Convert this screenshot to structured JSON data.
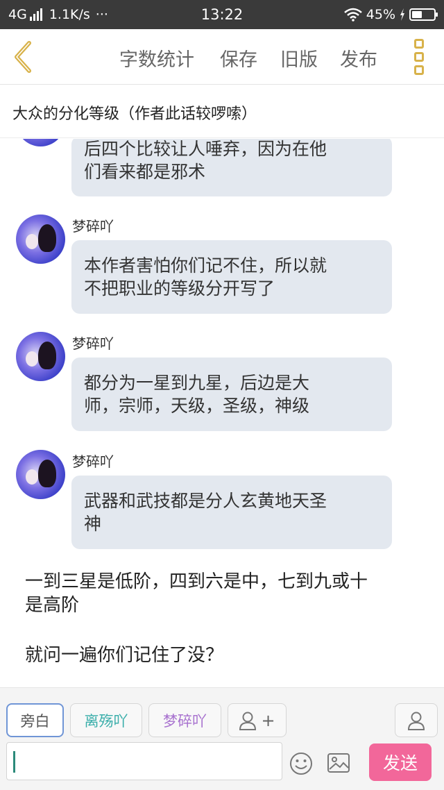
{
  "status_bar": {
    "network": "4G",
    "speed": "1.1K/s",
    "more": "···",
    "time": "13:22",
    "battery_text": "45%",
    "battery_level": 0.45
  },
  "toolbar": {
    "word_count": "字数统计",
    "save": "保存",
    "old_version": "旧版",
    "publish": "发布",
    "icons": [
      "chevron-left-icon",
      "more-vertical-icon"
    ]
  },
  "chapter": {
    "title": "大众的分化等级（作者此话较啰嗦）"
  },
  "messages": [
    {
      "name": "",
      "lines": [
        "后四个比较让人唾弃，因为在他",
        "们看来都是邪术"
      ]
    },
    {
      "name": "梦碎吖",
      "lines": [
        "本作者害怕你们记不住，所以就",
        "不把职业的等级分开写了"
      ]
    },
    {
      "name": "梦碎吖",
      "lines": [
        "都分为一星到九星，后边是大",
        "师，宗师，天级，圣级，神级"
      ]
    },
    {
      "name": "梦碎吖",
      "lines": [
        "武器和武技都是分人玄黄地天圣",
        "神"
      ]
    }
  ],
  "narration": {
    "line1": "一到三星是低阶，四到六是中，七到九或十",
    "line2": "是高阶",
    "line3": "就问一遍你们记住了没？"
  },
  "roles": {
    "narrator": "旁白",
    "role1": "离殇吖",
    "role1_color": "#3aaeaa",
    "role2": "梦碎吖",
    "role2_color": "#a872cf",
    "add_role_plus": "+"
  },
  "composer": {
    "send": "发送",
    "send_color": "#f2679a"
  }
}
